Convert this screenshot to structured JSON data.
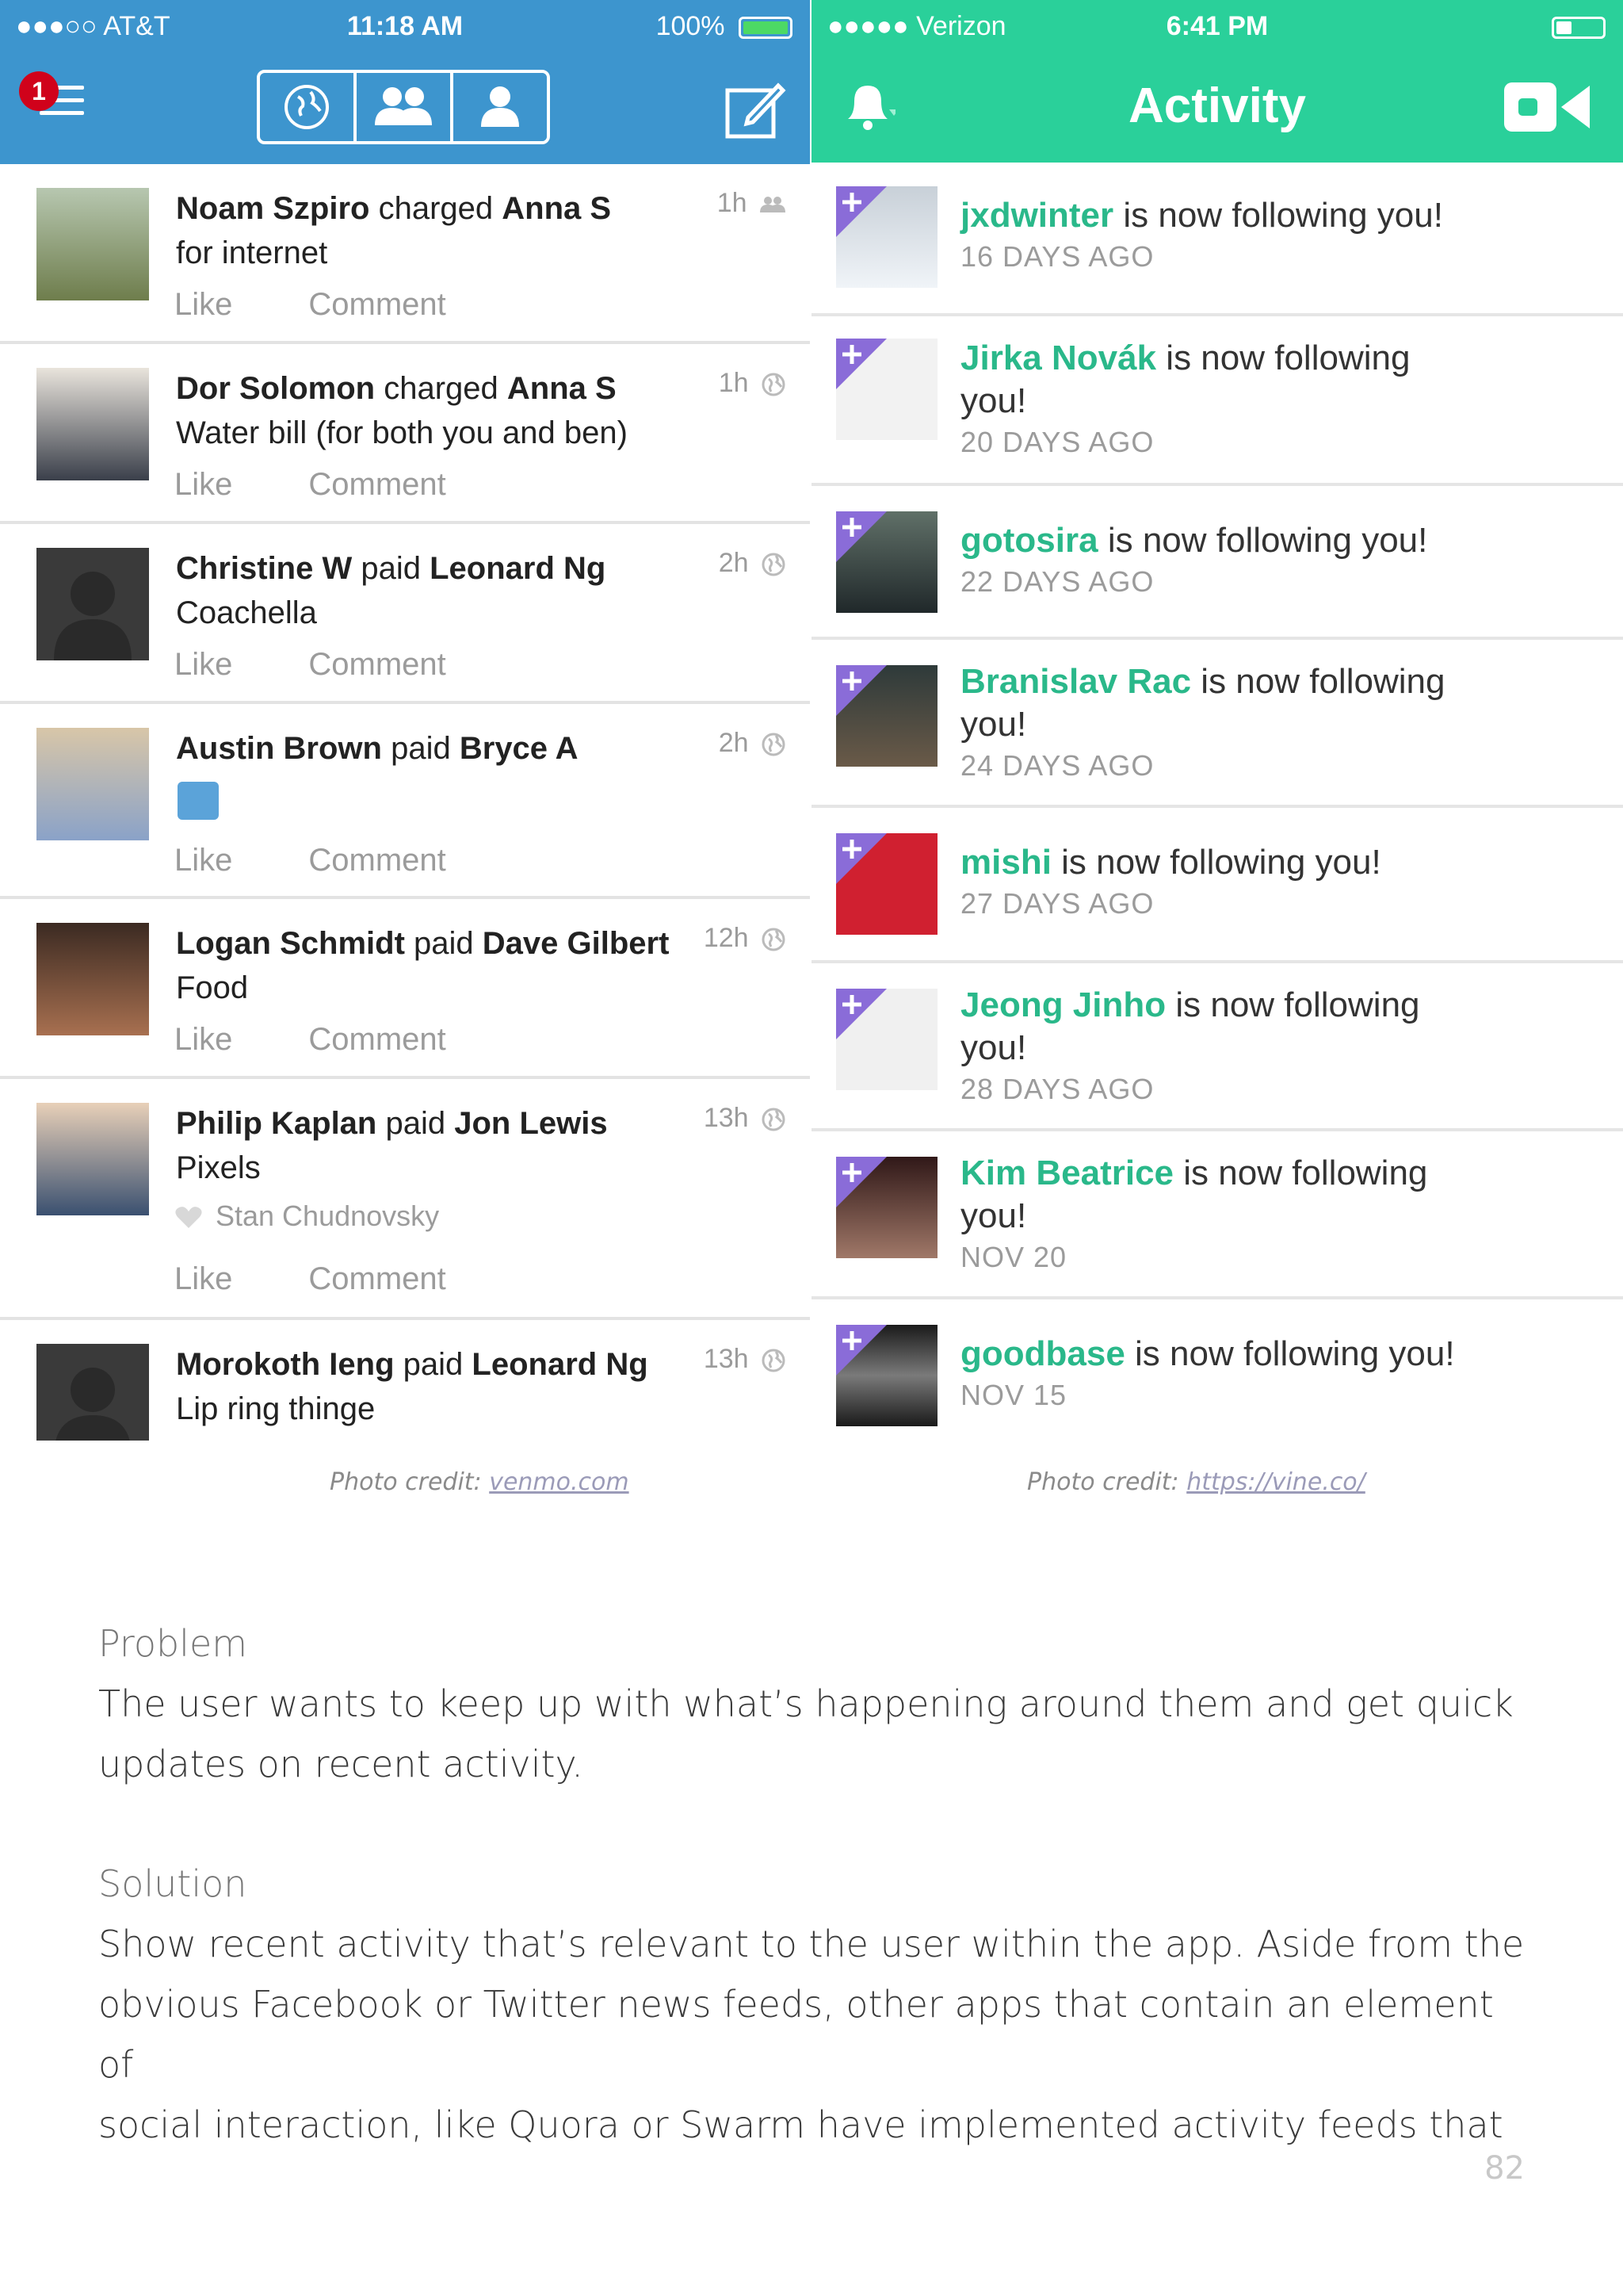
{
  "venmo": {
    "status": {
      "carrier": "●●●○○ AT&T",
      "time": "11:18 AM",
      "battery": "100%",
      "battery_level": 1.0
    },
    "menu_badge": "1",
    "feed": [
      {
        "actor": "Noam Szpiro",
        "verb": "charged",
        "target": "Anna S",
        "note": "for internet",
        "time": "1h",
        "like": "Like",
        "comment": "Comment"
      },
      {
        "actor": "Dor Solomon",
        "verb": "charged",
        "target": "Anna S",
        "note": "Water bill (for both you and ben)",
        "time": "1h",
        "like": "Like",
        "comment": "Comment"
      },
      {
        "actor": "Christine W",
        "verb": "paid",
        "target": "Leonard Ng",
        "note": "Coachella",
        "time": "2h",
        "like": "Like",
        "comment": "Comment"
      },
      {
        "actor": "Austin Brown",
        "verb": "paid",
        "target": "Bryce A",
        "note": "",
        "time": "2h",
        "like": "Like",
        "comment": "Comment"
      },
      {
        "actor": "Logan Schmidt",
        "verb": "paid",
        "target": "Dave Gilbert",
        "note": "Food",
        "time": "12h",
        "like": "Like",
        "comment": "Comment"
      },
      {
        "actor": "Philip Kaplan",
        "verb": "paid",
        "target": "Jon Lewis",
        "note": "Pixels",
        "time": "13h",
        "liker": "Stan Chudnovsky",
        "like": "Like",
        "comment": "Comment"
      },
      {
        "actor": "Morokoth Ieng",
        "verb": "paid",
        "target": "Leonard Ng",
        "note": "Lip ring thinge",
        "time": "13h"
      }
    ]
  },
  "vine": {
    "status": {
      "carrier": "●●●●● Verizon",
      "time": "6:41 PM"
    },
    "title": "Activity",
    "items": [
      {
        "user": "jxdwinter",
        "text": "is now following you!",
        "date": "16 DAYS AGO"
      },
      {
        "user": "Jirka Novák",
        "text": "is now following you!",
        "date": "20 DAYS AGO"
      },
      {
        "user": "gotosira",
        "text": "is now following you!",
        "date": "22 DAYS AGO"
      },
      {
        "user": "Branislav Rac",
        "text": "is now following you!",
        "date": "24 DAYS AGO"
      },
      {
        "user": "mishi",
        "text": "is now following you!",
        "date": "27 DAYS AGO"
      },
      {
        "user": "Jeong Jinho",
        "text": "is now following you!",
        "date": "28 DAYS AGO"
      },
      {
        "user": "Kim Beatrice",
        "text": "is now following you!",
        "date": "NOV 20"
      },
      {
        "user": "goodbase",
        "text": "is now following you!",
        "date": "NOV 15"
      }
    ]
  },
  "credits": {
    "left_label": "Photo credit: ",
    "left_link": "venmo.com",
    "right_label": "Photo credit: ",
    "right_link": "https://vine.co/"
  },
  "doc": {
    "problem_heading": "Problem",
    "problem_text_1": "The user wants to keep up with what’s happening around them and get quick",
    "problem_text_2": "updates on recent activity.",
    "solution_heading": "Solution",
    "solution_text_1": "Show recent activity that’s relevant to the user within the app. Aside from the",
    "solution_text_2": "obvious Facebook or Twitter news feeds, other apps that contain an element of",
    "solution_text_3": "social interaction, like Quora or Swarm have implemented activity feeds that",
    "page_number": "82"
  },
  "colors": {
    "venmo_blue": "#3d95ce",
    "vine_green": "#2ad09a",
    "vine_user": "#2ab88a"
  },
  "icons": [
    "wifi-icon",
    "menu-icon",
    "globe-icon",
    "friends-icon",
    "person-icon",
    "compose-icon",
    "bell-icon",
    "camera-icon",
    "follow-plus-icon",
    "heart-icon",
    "globe-small-icon",
    "friends-small-icon"
  ]
}
